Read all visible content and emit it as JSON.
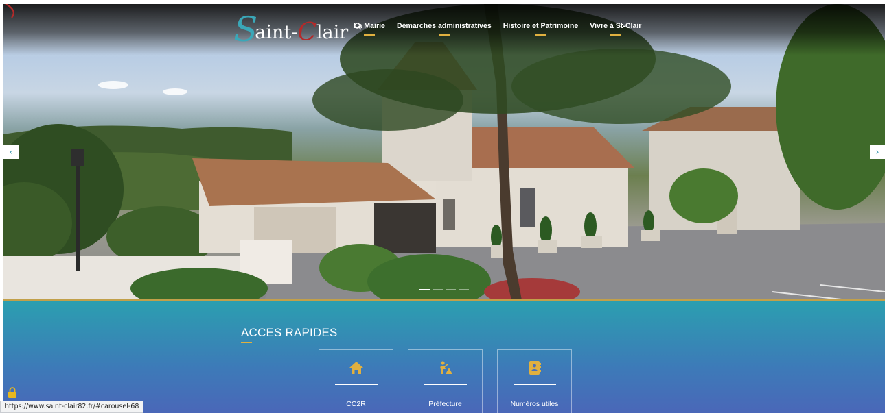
{
  "logo": {
    "first_letter": "S",
    "middle": "aint-",
    "second_letter": "C",
    "rest": "lair"
  },
  "nav": {
    "items": [
      {
        "label": "La Mairie"
      },
      {
        "label": "Démarches administratives"
      },
      {
        "label": "Histoire et Patrimoine"
      },
      {
        "label": "Vivre à St-Clair"
      }
    ],
    "search_icon": "search-icon"
  },
  "carousel": {
    "prev_label": "‹",
    "next_label": "›",
    "slide_count": 4,
    "active_slide": 1
  },
  "quick_access": {
    "title": "ACCES RAPIDES",
    "cards": [
      {
        "label": "CC2R",
        "icon": "home-icon"
      },
      {
        "label": "Préfecture",
        "icon": "road-worker-icon"
      },
      {
        "label": "Numéros utiles",
        "icon": "address-book-icon"
      }
    ]
  },
  "status_bar": {
    "url": "https://www.saint-clair82.fr/#carousel-68"
  },
  "colors": {
    "accent_gold": "#e0b040",
    "teal": "#2b9fb0",
    "blue": "#4a67b8",
    "logo_teal": "#3aa7b8",
    "logo_red": "#b32a2a"
  }
}
